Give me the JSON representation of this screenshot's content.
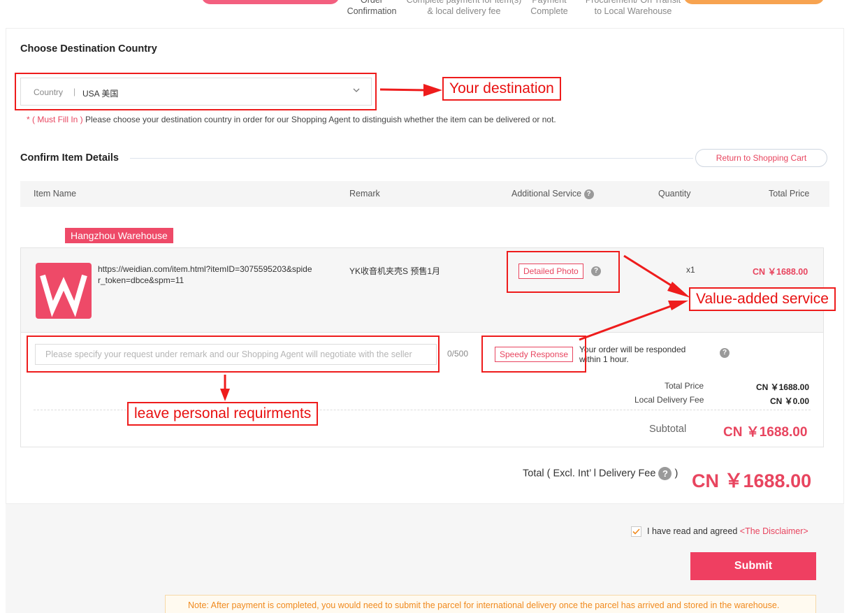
{
  "progress": {
    "steps": [
      {
        "line1": "Order",
        "line2": "Confirmation",
        "active": true
      },
      {
        "line1": "Complete payment for item(s)",
        "line2": "& local delivery fee",
        "active": false
      },
      {
        "line1": "Payment",
        "line2": "Complete",
        "active": false
      },
      {
        "line1": "Procurement/ On Transit",
        "line2": "to Local Warehouse",
        "active": false
      }
    ]
  },
  "destination": {
    "title": "Choose Destination Country",
    "field_label": "Country",
    "separator": "|",
    "selected_value": "USA 美国",
    "required_note": "* ( Must Fill In )",
    "hint": " Please choose your destination country in order for our Shopping Agent to distinguish whether the item can be delivered or not."
  },
  "items_section": {
    "title": "Confirm Item Details",
    "return_button": "Return to Shopping Cart",
    "columns": {
      "item_name": "Item Name",
      "remark": "Remark",
      "additional_service": "Additional Service",
      "quantity": "Quantity",
      "total_price": "Total Price"
    },
    "warehouse": "Hangzhou Warehouse",
    "item": {
      "logo_letter": "W",
      "url": "https://weidian.com/item.html?itemID=3075595203&spider_token=dbce&spm=11",
      "remark": "YK收音机夹壳S 预售1月",
      "service": "Detailed Photo",
      "quantity": "x1",
      "price": "CN ￥1688.00"
    },
    "remark_input": {
      "placeholder": "Please specify your request under remark and our Shopping Agent will negotiate with the seller",
      "value": "",
      "counter": "0/500"
    },
    "speedy": {
      "label": "Speedy Response",
      "description": "Your order will be responded within 1 hour."
    },
    "summary": {
      "total_price_label": "Total Price",
      "total_price_value": "CN ￥1688.00",
      "delivery_label": "Local Delivery Fee",
      "delivery_value": "CN ￥0.00",
      "subtotal_label": "Subtotal",
      "subtotal_value": "CN ￥1688.00"
    }
  },
  "total": {
    "label": "Total ( Excl. Int’ l Delivery Fee",
    "close_paren": ")",
    "value": "CN ￥1688.00"
  },
  "agreement": {
    "checked": true,
    "text": "I have read and agreed",
    "link": "<The Disclaimer>"
  },
  "submit_label": "Submit",
  "note": "Note: After payment is completed, you would need to submit the parcel for international delivery once the parcel has arrived and stored in the warehouse.",
  "annotations": {
    "destination": "Your destination",
    "value_added": "Value-added service",
    "personal": "leave personal requirments"
  },
  "colors": {
    "accent": "#e8455f",
    "submit": "#ef3f61",
    "annotation": "#ee1c1c",
    "note_text": "#f08a1e"
  }
}
